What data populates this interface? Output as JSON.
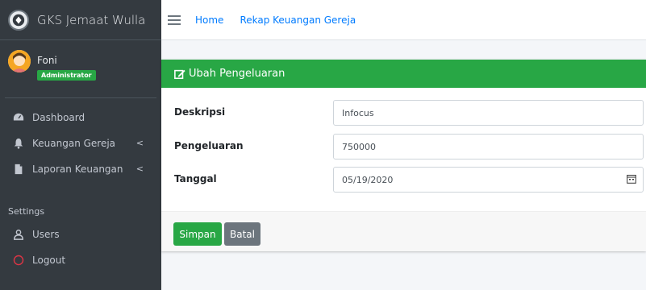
{
  "brand": {
    "name": "GKS Jemaat Wulla"
  },
  "user": {
    "name": "Foni",
    "role": "Administrator"
  },
  "sidebar": {
    "items": [
      {
        "label": "Dashboard"
      },
      {
        "label": "Keuangan Gereja"
      },
      {
        "label": "Laporan Keuangan"
      }
    ],
    "settings_header": "Settings",
    "settings_items": [
      {
        "label": "Users"
      },
      {
        "label": "Logout"
      }
    ],
    "chevron": "<"
  },
  "header": {
    "home_link": "Home",
    "page_link": "Rekap Keuangan Gereja"
  },
  "card": {
    "title": "Ubah Pengeluaran",
    "fields": [
      {
        "label": "Deskripsi",
        "value": "Infocus"
      },
      {
        "label": "Pengeluaran",
        "value": "750000"
      },
      {
        "label": "Tanggal",
        "value": "05/19/2020"
      }
    ],
    "save_label": "Simpan",
    "cancel_label": "Batal"
  },
  "colors": {
    "sidebar_bg": "#343a40",
    "accent_green": "#28a745",
    "link_blue": "#007bff",
    "secondary": "#6c757d",
    "logout_red": "#dc3545"
  },
  "icons": [
    "gks-logo-icon",
    "user-avatar-icon",
    "dashboard-icon",
    "bell-icon",
    "file-icon",
    "users-icon",
    "logout-circle-icon",
    "hamburger-icon",
    "edit-icon",
    "calendar-icon"
  ]
}
